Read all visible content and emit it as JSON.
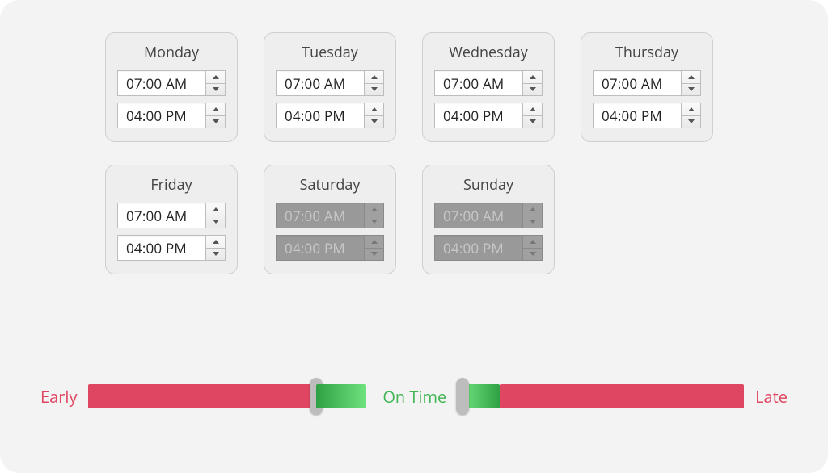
{
  "days": [
    {
      "label": "Monday",
      "start": "07:00 AM",
      "end": "04:00 PM",
      "enabled": true
    },
    {
      "label": "Tuesday",
      "start": "07:00 AM",
      "end": "04:00 PM",
      "enabled": true
    },
    {
      "label": "Wednesday",
      "start": "07:00 AM",
      "end": "04:00 PM",
      "enabled": true
    },
    {
      "label": "Thursday",
      "start": "07:00 AM",
      "end": "04:00 PM",
      "enabled": true
    },
    {
      "label": "Friday",
      "start": "07:00 AM",
      "end": "04:00 PM",
      "enabled": true
    },
    {
      "label": "Saturday",
      "start": "07:00 AM",
      "end": "04:00 PM",
      "enabled": false
    },
    {
      "label": "Sunday",
      "start": "07:00 AM",
      "end": "04:00 PM",
      "enabled": false
    }
  ],
  "slider": {
    "early_label": "Early",
    "ontime_label": "On Time",
    "late_label": "Late",
    "early_color": "#df4661",
    "ontime_color": "#41b553",
    "late_color": "#df4661"
  }
}
